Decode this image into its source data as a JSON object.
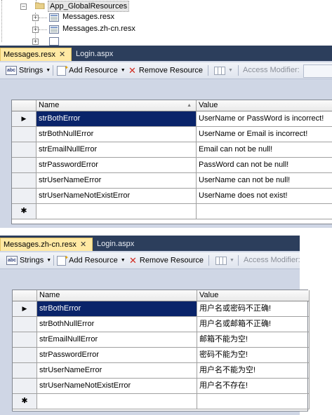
{
  "tree": {
    "folder_label": "App_GlobalResources",
    "files": [
      {
        "label": "Messages.resx"
      },
      {
        "label": "Messages.zh-cn.resx"
      }
    ]
  },
  "panels": [
    {
      "tabs": [
        {
          "label": "Messages.resx",
          "active": true,
          "close": "✕"
        },
        {
          "label": "Login.aspx",
          "active": false
        }
      ],
      "toolbar": {
        "strings_label": "Strings",
        "add_label": "Add Resource",
        "remove_label": "Remove Resource",
        "access_label": "Access Modifier:"
      },
      "grid": {
        "columns": [
          "Name",
          "Value"
        ],
        "rows": [
          {
            "name": "strBothError",
            "value": "UserName or PassWord is incorrect!"
          },
          {
            "name": "strBothNullError",
            "value": "UserName or Email is incorrect!"
          },
          {
            "name": "strEmailNullError",
            "value": "Email can not be null!"
          },
          {
            "name": "strPasswordError",
            "value": "PassWord can not be null!"
          },
          {
            "name": "strUserNameError",
            "value": "UserName can not be null!"
          },
          {
            "name": "strUserNameNotExistError",
            "value": "UserName does not exist!"
          }
        ],
        "new_row_marker": "✱"
      }
    },
    {
      "tabs": [
        {
          "label": "Messages.zh-cn.resx",
          "active": true,
          "close": "✕"
        },
        {
          "label": "Login.aspx",
          "active": false
        }
      ],
      "toolbar": {
        "strings_label": "Strings",
        "add_label": "Add Resource",
        "remove_label": "Remove Resource",
        "access_label": "Access Modifier:"
      },
      "grid": {
        "columns": [
          "Name",
          "Value"
        ],
        "rows": [
          {
            "name": "strBothError",
            "value": "用户名或密码不正确!"
          },
          {
            "name": "strBothNullError",
            "value": "用户名或邮箱不正确!"
          },
          {
            "name": "strEmailNullError",
            "value": "邮箱不能为空!"
          },
          {
            "name": "strPasswordError",
            "value": "密码不能为空!"
          },
          {
            "name": "strUserNameError",
            "value": "用户名不能为空!"
          },
          {
            "name": "strUserNameNotExistError",
            "value": "用户名不存在!"
          }
        ],
        "new_row_marker": "✱"
      }
    }
  ]
}
